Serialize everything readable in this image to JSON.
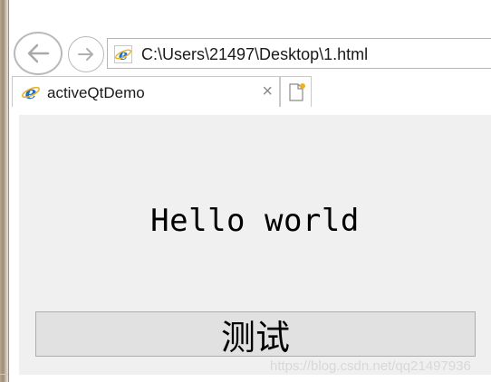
{
  "navigation": {
    "back_icon": "arrow-left-icon",
    "forward_icon": "arrow-right-icon",
    "address": "C:\\Users\\21497\\Desktop\\1.html",
    "address_icon": "ie-icon"
  },
  "tabs": [
    {
      "label": "activeQtDemo",
      "icon": "ie-icon",
      "close": "×"
    }
  ],
  "new_tab_icon": "new-tab-icon",
  "page": {
    "greeting": "Hello world",
    "button_label": "测试"
  },
  "watermark": "https://blog.csdn.net/qq21497936",
  "colors": {
    "content_bg": "#f0f0f0",
    "button_bg": "#e1e1e1",
    "ie_blue": "#1f6fc5",
    "ie_gold": "#e8b22a"
  }
}
